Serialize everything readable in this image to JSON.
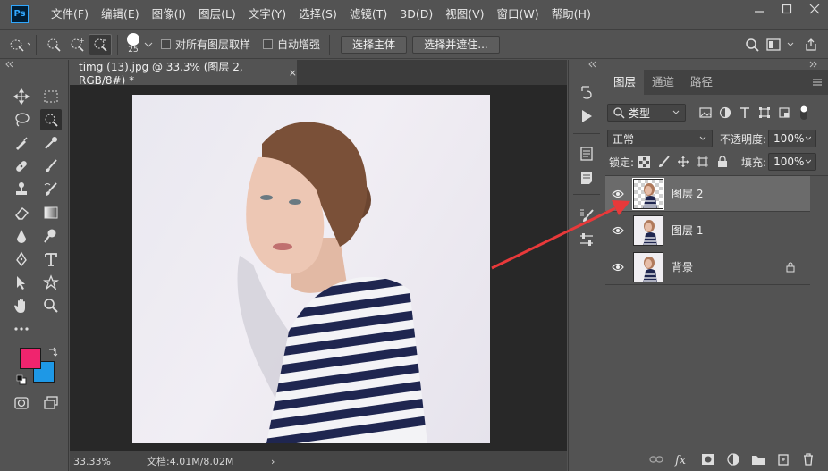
{
  "app": {
    "logo": "Ps"
  },
  "menu": [
    "文件(F)",
    "编辑(E)",
    "图像(I)",
    "图层(L)",
    "文字(Y)",
    "选择(S)",
    "滤镜(T)",
    "3D(D)",
    "视图(V)",
    "窗口(W)",
    "帮助(H)"
  ],
  "options": {
    "brush_size": "25",
    "sample_all_layers": "对所有图层取样",
    "auto_enhance": "自动增强",
    "select_subject": "选择主体",
    "select_and_mask": "选择并遮住..."
  },
  "document": {
    "tab_title": "timg (13).jpg @ 33.3% (图层 2, RGB/8#) *",
    "close": "×",
    "zoom": "33.33%",
    "doc_info": "文档:4.01M/8.02M",
    "status_arrow": "›"
  },
  "panel": {
    "tabs": [
      "图层",
      "通道",
      "路径"
    ],
    "filter_label": "类型",
    "blend_mode": "正常",
    "opacity_label": "不透明度:",
    "opacity_value": "100%",
    "lock_label": "锁定:",
    "fill_label": "填充:",
    "fill_value": "100%",
    "layers": [
      {
        "name": "图层 2",
        "selected": true
      },
      {
        "name": "图层 1",
        "selected": false
      },
      {
        "name": "背景",
        "selected": false,
        "locked": true
      }
    ]
  },
  "colors": {
    "foreground": "#f0246e",
    "background": "#1e98e6",
    "annotation_arrow": "#e8393a",
    "layer_selected": "#6b6b6b"
  }
}
